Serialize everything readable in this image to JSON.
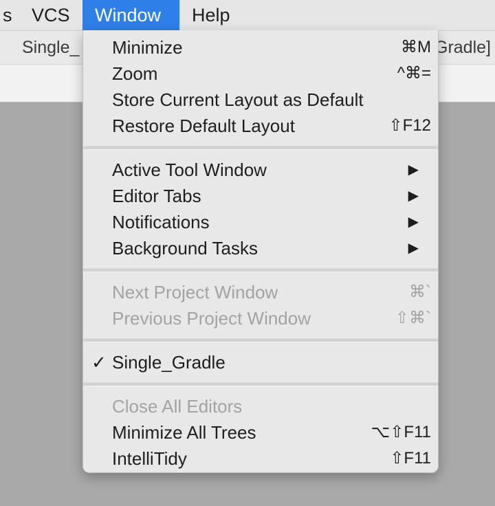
{
  "menubar": {
    "items": [
      "s",
      "VCS",
      "Window",
      "Help"
    ],
    "active": "Window"
  },
  "titlebar": {
    "left_fragment": "Single_",
    "right_fragment": "Gradle]"
  },
  "menu": {
    "groups": [
      [
        {
          "label": "Minimize",
          "shortcut": "⌘M",
          "enabled": true
        },
        {
          "label": "Zoom",
          "shortcut": "^⌘=",
          "enabled": true
        },
        {
          "label": "Store Current Layout as Default",
          "shortcut": "",
          "enabled": true
        },
        {
          "label": "Restore Default Layout",
          "shortcut": "⇧F12",
          "enabled": true
        }
      ],
      [
        {
          "label": "Active Tool Window",
          "submenu": true,
          "enabled": true
        },
        {
          "label": "Editor Tabs",
          "submenu": true,
          "enabled": true
        },
        {
          "label": "Notifications",
          "submenu": true,
          "enabled": true
        },
        {
          "label": "Background Tasks",
          "submenu": true,
          "enabled": true
        }
      ],
      [
        {
          "label": "Next Project Window",
          "shortcut": "⌘`",
          "enabled": false
        },
        {
          "label": "Previous Project Window",
          "shortcut": "⇧⌘`",
          "enabled": false
        }
      ],
      [
        {
          "label": "Single_Gradle",
          "checked": true,
          "enabled": true
        }
      ],
      [
        {
          "label": "Close All Editors",
          "shortcut": "",
          "enabled": false
        },
        {
          "label": "Minimize All Trees",
          "shortcut": "⌥⇧F11",
          "enabled": true
        },
        {
          "label": "IntelliTidy",
          "shortcut": "⇧F11",
          "enabled": true
        }
      ]
    ],
    "submenu_glyph": "▶",
    "check_glyph": "✓"
  }
}
